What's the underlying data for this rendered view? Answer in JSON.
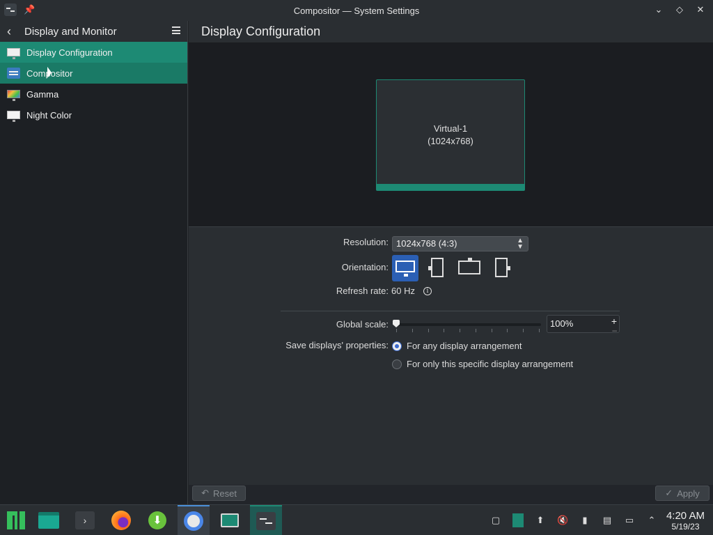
{
  "window": {
    "title": "Compositor — System Settings"
  },
  "sidebar": {
    "title": "Display and Monitor",
    "items": [
      {
        "label": "Display Configuration",
        "icon": "monitor-icon"
      },
      {
        "label": "Compositor",
        "icon": "compositor-icon"
      },
      {
        "label": "Gamma",
        "icon": "gamma-icon"
      },
      {
        "label": "Night Color",
        "icon": "night-color-icon"
      }
    ]
  },
  "main": {
    "title": "Display Configuration",
    "display": {
      "name": "Virtual-1",
      "resolution": "(1024x768)"
    },
    "resolution": {
      "label": "Resolution:",
      "value": "1024x768 (4:3)"
    },
    "orientation": {
      "label": "Orientation:"
    },
    "refresh": {
      "label": "Refresh rate:",
      "value": "60 Hz"
    },
    "global_scale": {
      "label": "Global scale:",
      "value": "100%"
    },
    "save_props": {
      "label": "Save displays' properties:",
      "option1": "For any display arrangement",
      "option2": "For only this specific display arrangement"
    },
    "reset_label": "Reset",
    "apply_label": "Apply"
  },
  "taskbar": {
    "time": "4:20 AM",
    "date": "5/19/23"
  },
  "colors": {
    "accent": "#1d8a74",
    "selection": "#2b5fb4"
  }
}
